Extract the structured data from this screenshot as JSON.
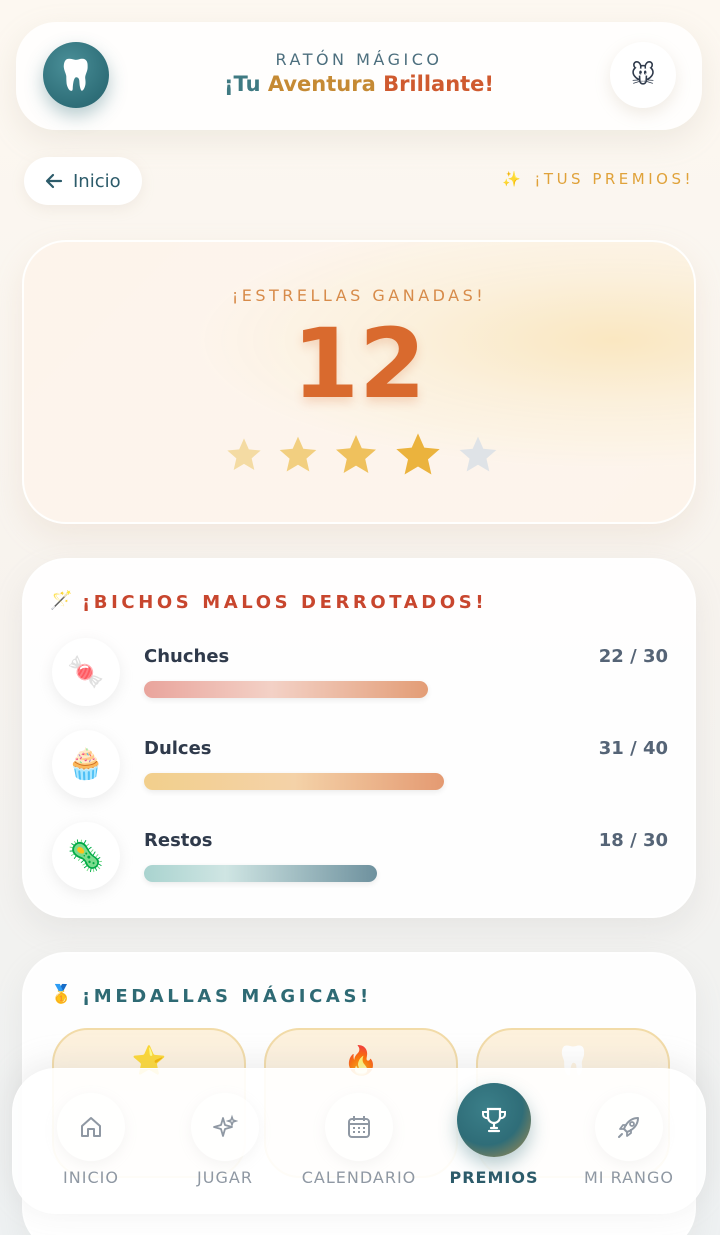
{
  "header": {
    "app_name": "RATÓN MÁGICO",
    "tagline_part1": "¡Tu ",
    "tagline_part2": "Aventura ",
    "tagline_part3": "Brillante!",
    "logo_icon": "🦷",
    "avatar_icon": "🐭"
  },
  "nav_back": {
    "label": "Inicio"
  },
  "section": {
    "label": "¡TUS PREMIOS!",
    "icon": "✨"
  },
  "stars": {
    "caption": "¡ESTRELLAS GANADAS!",
    "count": "12",
    "filled": 4,
    "total": 5
  },
  "bugs": {
    "icon": "🪄",
    "title": "¡BICHOS MALOS DERROTADOS!",
    "items": [
      {
        "icon": "🍬",
        "name": "Chuches",
        "current": 22,
        "max": 30,
        "count_label": "22 / 30"
      },
      {
        "icon": "🧁",
        "name": "Dulces",
        "current": 31,
        "max": 40,
        "count_label": "31 / 40"
      },
      {
        "icon": "🦠",
        "name": "Restos",
        "current": 18,
        "max": 30,
        "count_label": "18 / 30"
      }
    ]
  },
  "medals": {
    "icon": "🥇",
    "title": "¡MEDALLAS MÁGICAS!",
    "tiles": [
      "⭐",
      "🔥",
      "🦷"
    ]
  },
  "bottom_nav": {
    "items": [
      {
        "label": "INICIO",
        "icon": "home-icon",
        "active": false
      },
      {
        "label": "JUGAR",
        "icon": "sparkles-icon",
        "active": false
      },
      {
        "label": "CALENDARIO",
        "icon": "calendar-icon",
        "active": false
      },
      {
        "label": "PREMIOS",
        "icon": "trophy-icon",
        "active": true
      },
      {
        "label": "MI RANGO",
        "icon": "rocket-icon",
        "active": false
      }
    ]
  },
  "colors": {
    "accent": "#2e6e78",
    "gold": "#e0a23a",
    "orange": "#d96a2e",
    "red": "#c8462e"
  }
}
